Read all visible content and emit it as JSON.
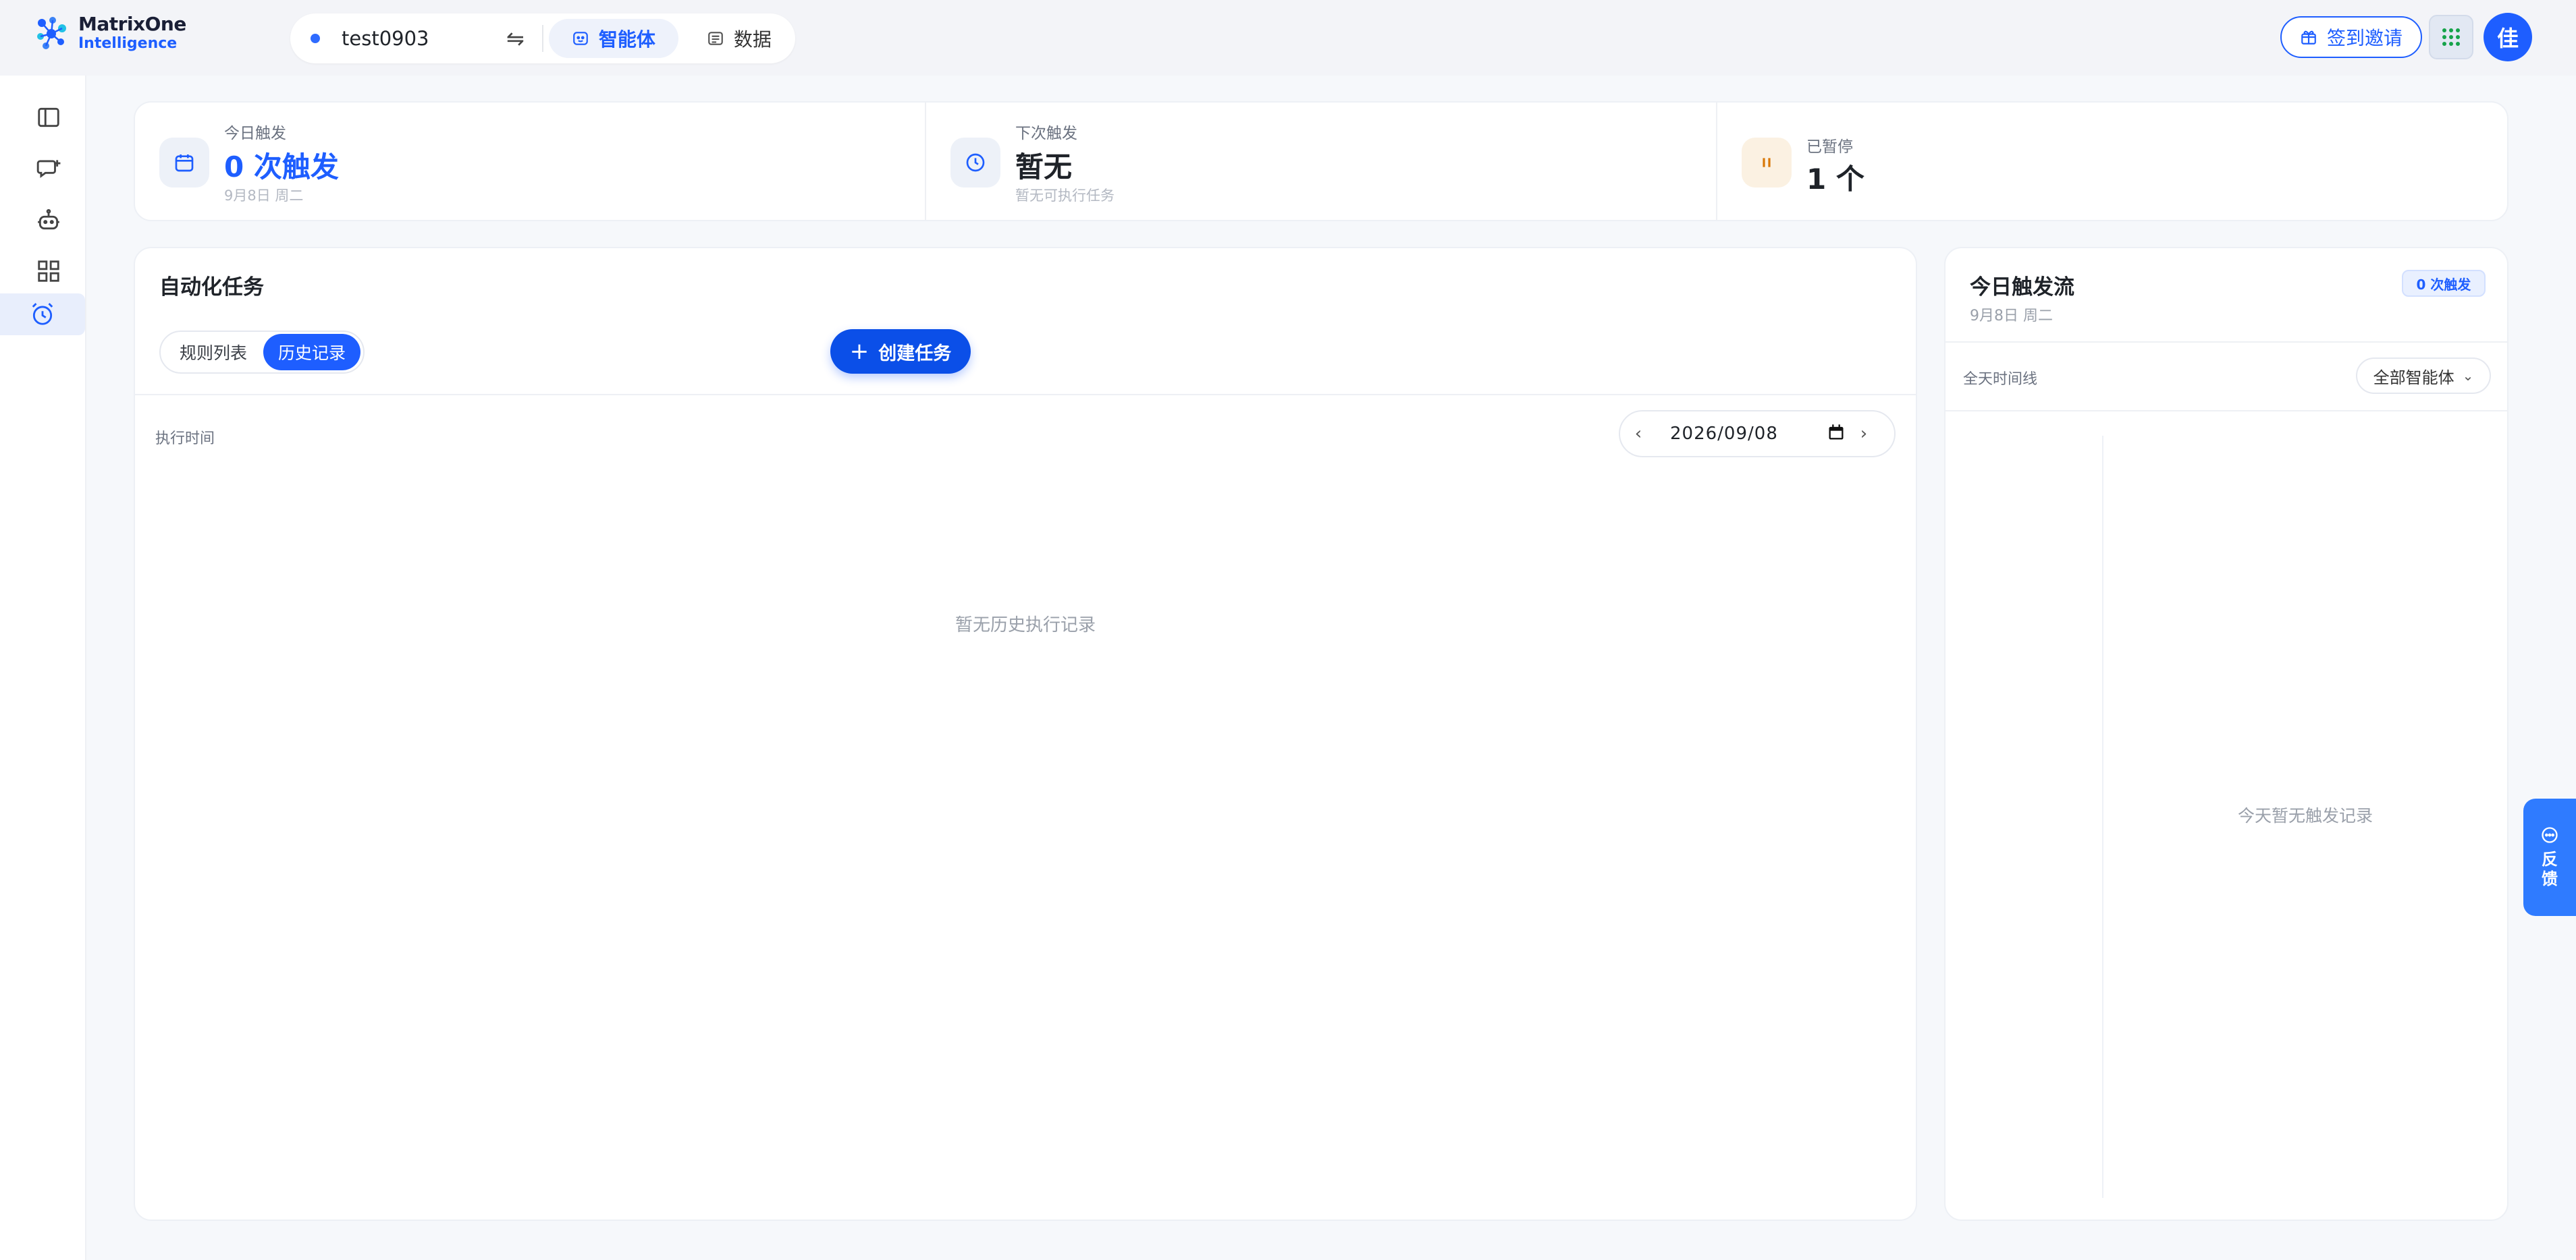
{
  "header": {
    "logo": {
      "line1": "MatrixOne",
      "line2": "Intelligence"
    },
    "workspace": {
      "name": "test0903",
      "swap_glyph": "⇋"
    },
    "tabs": [
      {
        "label": "智能体",
        "icon": "agent-icon",
        "active": true
      },
      {
        "label": "数据",
        "icon": "data-icon",
        "active": false
      }
    ],
    "invite_label": "签到邀请",
    "avatar_text": "佳"
  },
  "sidebar": {
    "items": [
      {
        "icon": "sidebar-toggle-icon"
      },
      {
        "icon": "new-chat-icon"
      },
      {
        "icon": "robot-icon"
      },
      {
        "icon": "apps-grid-icon"
      },
      {
        "icon": "alarm-clock-icon",
        "active": true
      }
    ]
  },
  "stats": {
    "today": {
      "label": "今日触发",
      "value": "0 次触发",
      "sub": "9月8日 周二",
      "icon": "calendar-icon"
    },
    "next": {
      "label": "下次触发",
      "value": "暂无",
      "sub": "暂无可执行任务",
      "icon": "clock-icon"
    },
    "paused": {
      "label": "已暂停",
      "value": "1 个",
      "icon": "pause-icon"
    }
  },
  "main": {
    "title": "自动化任务",
    "segments": [
      {
        "label": "规则列表",
        "active": false
      },
      {
        "label": "历史记录",
        "active": true
      }
    ],
    "create_label": "创建任务",
    "create_glyph": "+",
    "column_label": "执行时间",
    "date": {
      "value": "2026/09/08",
      "prev": "‹",
      "next": "›"
    },
    "empty": "暂无历史执行记录"
  },
  "flow": {
    "title": "今日触发流",
    "date": "9月8日 周二",
    "badge": "0 次触发",
    "timeline_label": "全天时间线",
    "filter": "全部智能体",
    "filter_chevron": "⌄",
    "empty": "今天暂无触发记录"
  },
  "feedback": {
    "label": "反馈"
  },
  "colors": {
    "accent": "#1e5eff",
    "accent_dark": "#0b4fe8",
    "feedback": "#2f7bff"
  }
}
